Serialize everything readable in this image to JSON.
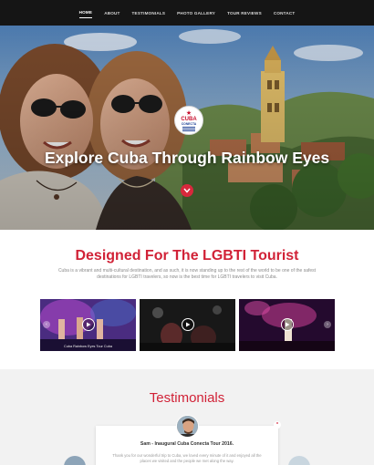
{
  "nav": {
    "items": [
      {
        "label": "HOME",
        "active": true
      },
      {
        "label": "ABOUT",
        "active": false
      },
      {
        "label": "TESTIMONIALS",
        "active": false
      },
      {
        "label": "PHOTO GALLERY",
        "active": false
      },
      {
        "label": "TOUR REVIEWS",
        "active": false
      },
      {
        "label": "CONTACT",
        "active": false
      }
    ]
  },
  "hero": {
    "logo": {
      "line1": "CUBA",
      "line2": "CONECTA"
    },
    "title": "Explore Cuba Through Rainbow Eyes",
    "scroll_icon": "chevron-down-icon"
  },
  "intro": {
    "title": "Designed For The LGBTI Tourist",
    "text": "Cuba is a vibrant and multi-cultural destination, and as such, it is now standing up to the rest of the world to be one of the safest destinations for LGBTI travelers, so now is the best time for LGBTI travelers to visit Cuba."
  },
  "videos": [
    {
      "caption": "Cuba Rainbow Eyes Tour Cuba",
      "play_icon": "play-icon"
    },
    {
      "caption": "",
      "play_icon": "play-icon"
    },
    {
      "caption": "",
      "play_icon": "play-icon"
    }
  ],
  "testimonials": {
    "title": "Testimonials",
    "name": "Sam - Inaugural Cuba Conecta Tour 2016.",
    "quote": "Thank you for our wonderful trip to Cuba, we loved every minute of it and enjoyed all the places we visited and the people we met along the way."
  },
  "colors": {
    "accent": "#d12237",
    "nav_bg": "#151515",
    "band_bg": "#f2f2f2"
  }
}
